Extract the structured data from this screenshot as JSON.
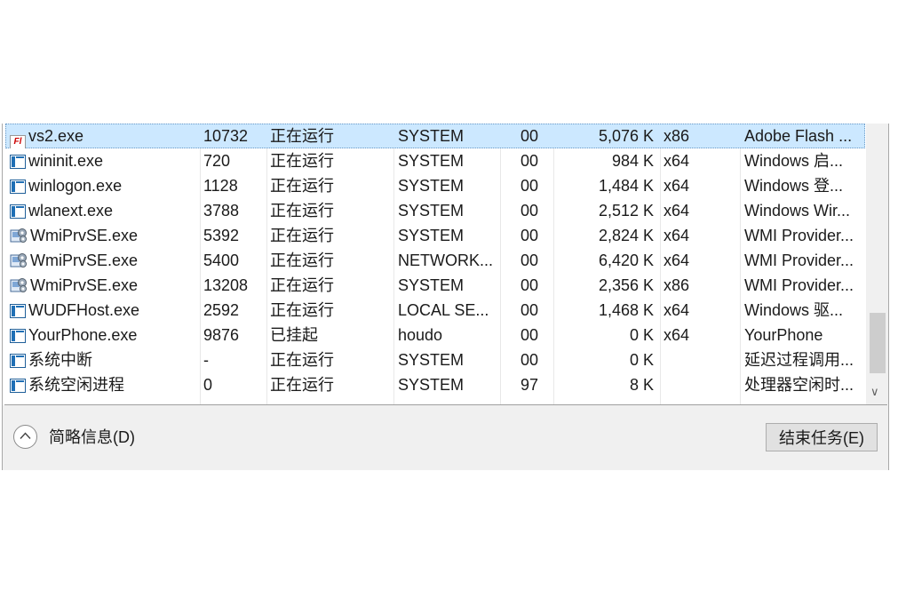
{
  "processes": [
    {
      "name": "vs2.exe",
      "pid": "10732",
      "status": "正在运行",
      "user": "SYSTEM",
      "cpu": "00",
      "memory": "5,076 K",
      "arch": "x86",
      "description": "Adobe Flash ...",
      "icon": "flash-icon",
      "selected": true
    },
    {
      "name": "wininit.exe",
      "pid": "720",
      "status": "正在运行",
      "user": "SYSTEM",
      "cpu": "00",
      "memory": "984 K",
      "arch": "x64",
      "description": "Windows 启...",
      "icon": "window-app-icon"
    },
    {
      "name": "winlogon.exe",
      "pid": "1128",
      "status": "正在运行",
      "user": "SYSTEM",
      "cpu": "00",
      "memory": "1,484 K",
      "arch": "x64",
      "description": "Windows 登...",
      "icon": "window-app-icon"
    },
    {
      "name": "wlanext.exe",
      "pid": "3788",
      "status": "正在运行",
      "user": "SYSTEM",
      "cpu": "00",
      "memory": "2,512 K",
      "arch": "x64",
      "description": "Windows Wir...",
      "icon": "window-app-icon"
    },
    {
      "name": "WmiPrvSE.exe",
      "pid": "5392",
      "status": "正在运行",
      "user": "SYSTEM",
      "cpu": "00",
      "memory": "2,824 K",
      "arch": "x64",
      "description": "WMI Provider...",
      "icon": "wmi-gear-icon"
    },
    {
      "name": "WmiPrvSE.exe",
      "pid": "5400",
      "status": "正在运行",
      "user": "NETWORK...",
      "cpu": "00",
      "memory": "6,420 K",
      "arch": "x64",
      "description": "WMI Provider...",
      "icon": "wmi-gear-icon"
    },
    {
      "name": "WmiPrvSE.exe",
      "pid": "13208",
      "status": "正在运行",
      "user": "SYSTEM",
      "cpu": "00",
      "memory": "2,356 K",
      "arch": "x86",
      "description": "WMI Provider...",
      "icon": "wmi-gear-icon"
    },
    {
      "name": "WUDFHost.exe",
      "pid": "2592",
      "status": "正在运行",
      "user": "LOCAL SE...",
      "cpu": "00",
      "memory": "1,468 K",
      "arch": "x64",
      "description": "Windows 驱...",
      "icon": "window-app-icon"
    },
    {
      "name": "YourPhone.exe",
      "pid": "9876",
      "status": "已挂起",
      "user": "houdo",
      "cpu": "00",
      "memory": "0 K",
      "arch": "x64",
      "description": "YourPhone",
      "icon": "window-app-icon"
    },
    {
      "name": "系统中断",
      "pid": "-",
      "status": "正在运行",
      "user": "SYSTEM",
      "cpu": "00",
      "memory": "0 K",
      "arch": "",
      "description": "延迟过程调用...",
      "icon": "window-app-icon"
    },
    {
      "name": "系统空闲进程",
      "pid": "0",
      "status": "正在运行",
      "user": "SYSTEM",
      "cpu": "97",
      "memory": "8 K",
      "arch": "",
      "description": "处理器空闲时...",
      "icon": "window-app-icon"
    }
  ],
  "footer": {
    "fewer_details_label": "简略信息(D)",
    "end_task_label": "结束任务(E)"
  },
  "colors": {
    "selection": "#cce8ff",
    "footer_bg": "#f0f0f0"
  }
}
